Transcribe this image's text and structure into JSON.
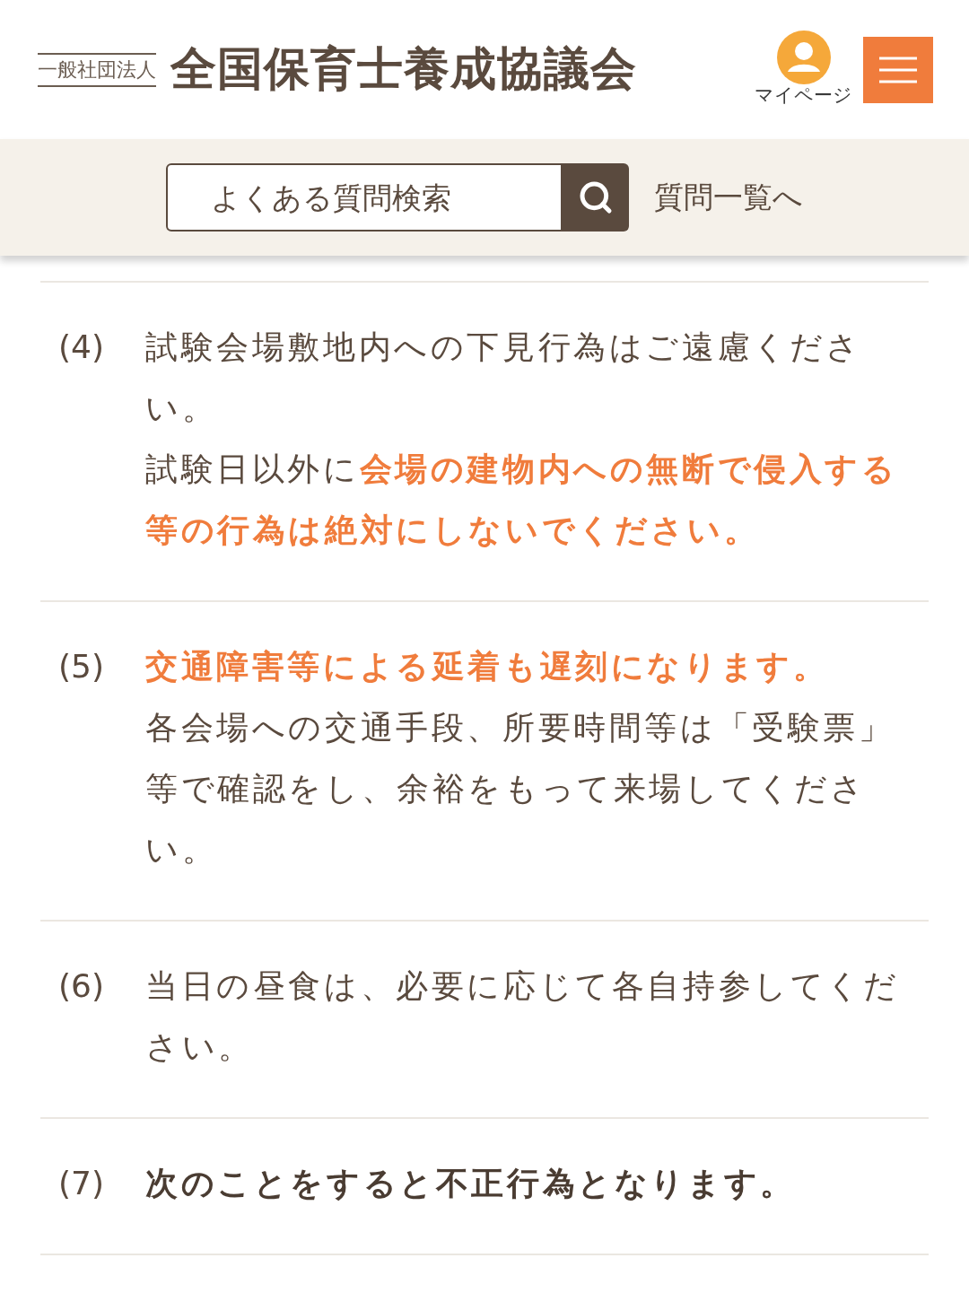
{
  "header": {
    "org_type": "一般社団法人",
    "org_name": "全国保育士養成協議会",
    "mypage_label": "マイページ"
  },
  "search": {
    "placeholder": "よくある質問検索",
    "list_link": "質問一覧へ"
  },
  "items": [
    {
      "number": "(4)",
      "bold": false,
      "paragraphs": [
        "試験会場敷地内への下見行為はご遠慮ください。",
        "試験日以外に**会場の建物内への無断で侵入する等の行為は絶対にしないでください。**"
      ]
    },
    {
      "number": "(5)",
      "bold": false,
      "paragraphs": [
        "**交通障害等による延着も遅刻になります。**",
        "各会場への交通手段、所要時間等は「受験票」等で確認をし、余裕をもって来場してください。"
      ]
    },
    {
      "number": "(6)",
      "bold": false,
      "paragraphs": [
        "当日の昼食は、必要に応じて各自持参してください。"
      ]
    },
    {
      "number": "(7)",
      "bold": true,
      "paragraphs": [
        "次のことをすると不正行為となります。"
      ]
    }
  ]
}
